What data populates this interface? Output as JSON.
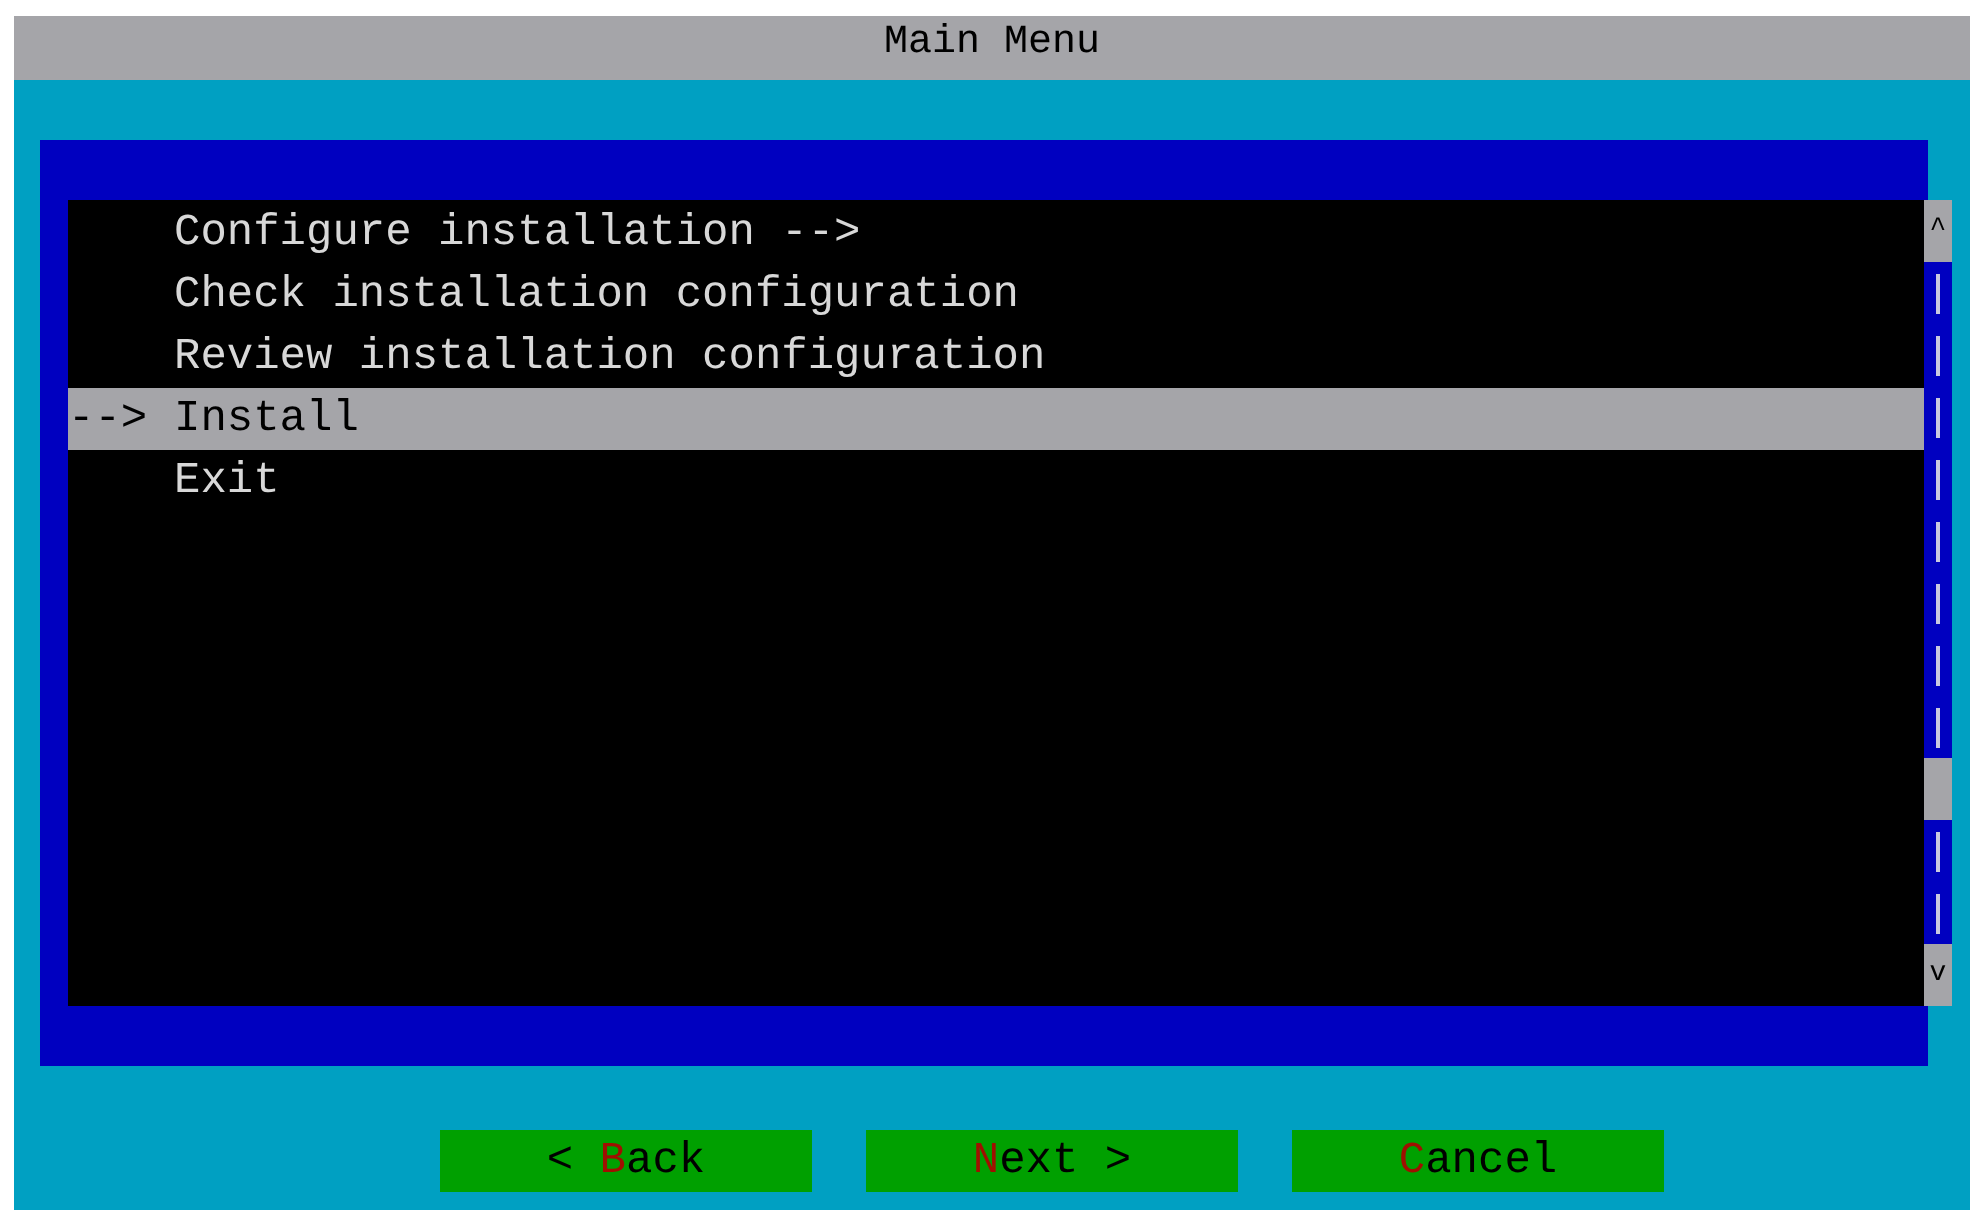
{
  "window": {
    "title": "Main Menu"
  },
  "menu": {
    "cursor": "-->",
    "items": [
      {
        "label": "Configure installation -->",
        "selected": false
      },
      {
        "label": "Check installation configuration",
        "selected": false
      },
      {
        "label": "Review installation configuration",
        "selected": false
      },
      {
        "label": "Install",
        "selected": true
      },
      {
        "label": "Exit",
        "selected": false
      }
    ]
  },
  "scrollbar": {
    "up": "^",
    "down": "v"
  },
  "buttons": [
    {
      "before": "< ",
      "hotkey": "B",
      "after": "ack"
    },
    {
      "hotkey": "N",
      "after": "ext >"
    },
    {
      "hotkey": "C",
      "after": "ancel"
    }
  ]
}
